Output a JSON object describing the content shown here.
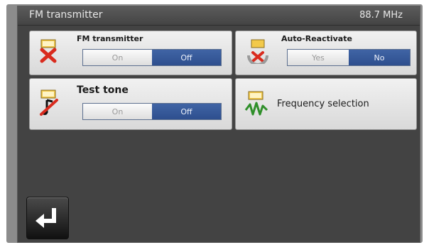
{
  "header": {
    "title": "FM transmitter",
    "frequency": "88.7 MHz"
  },
  "cards": {
    "fm_transmitter": {
      "label": "FM transmitter",
      "options": [
        "On",
        "Off"
      ],
      "selected": "Off"
    },
    "auto_reactivate": {
      "label": "Auto-Reactivate",
      "options": [
        "Yes",
        "No"
      ],
      "selected": "No"
    },
    "test_tone": {
      "label": "Test tone",
      "options": [
        "On",
        "Off"
      ],
      "selected": "Off"
    },
    "frequency_selection": {
      "label": "Frequency selection"
    }
  },
  "icons": {
    "fm_transmitter": "fm-transmitter-disabled-icon",
    "auto_reactivate": "auto-reactivate-icon",
    "test_tone": "test-tone-muted-icon",
    "frequency_selection": "frequency-wave-icon",
    "back": "back-arrow-icon"
  },
  "colors": {
    "selected": "#34579a",
    "background": "#434343",
    "card": "#e6e6e6"
  }
}
